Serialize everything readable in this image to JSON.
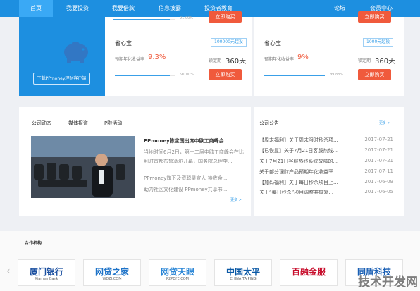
{
  "nav": {
    "items": [
      "首页",
      "我要投资",
      "我要借款",
      "信息披露",
      "投资者教育",
      "论坛",
      "会员中心"
    ]
  },
  "banner": {
    "download_label": "下载PPmoney理财客户端"
  },
  "products": [
    {
      "progress_text": "91.00%",
      "buy_label": "立即购买",
      "progress": 0.91
    },
    {
      "buy_label": "立即购买"
    },
    {
      "name": "省心宝",
      "tag": "100000元起投",
      "rate_label": "预期年化收益率",
      "rate": "9.3%",
      "period_label": "锁定期",
      "period": "360天",
      "progress_text": "91.00%",
      "progress": 0.91,
      "buy_label": "立即购买"
    },
    {
      "name": "省心宝",
      "tag": "1000元起投",
      "rate_label": "预期年化收益率",
      "rate": "9%",
      "period_label": "锁定期",
      "period": "360天",
      "progress_text": "99.88%",
      "progress": 0.9988,
      "buy_label": "立即购买"
    }
  ],
  "news": {
    "tabs": [
      "公司动态",
      "媒体报道",
      "P啦活动"
    ],
    "headline": "PPmoney陈宝国出席中欧工商峰会",
    "summary": [
      "当地时间6月2日，第十二届中欧工商峰会在比",
      "利时首都布鲁塞尔开幕，国务院总理李..."
    ],
    "items": [
      "PPmoney旗下及资聪星宣人 待收余...",
      "助力社区文化建设 PPmoney共享书..."
    ],
    "more": "更多 >"
  },
  "announcements": {
    "title": "公司公告",
    "more": "更多 >",
    "items": [
      {
        "text": "【周末福利】关于周末限时秒杀项...",
        "date": "2017-07-21"
      },
      {
        "text": "【已恢复】关于7月21日客服热线...",
        "date": "2017-07-21"
      },
      {
        "text": "关于7月21日客服热线系统故障的...",
        "date": "2017-07-21"
      },
      {
        "text": "关于部分理财产品预期年化收益率...",
        "date": "2017-07-11"
      },
      {
        "text": "【加码福利】关于每日秒杀项目上...",
        "date": "2017-06-09"
      },
      {
        "text": "关于“每日秒杀”项目调整并恢复...",
        "date": "2017-06-05"
      }
    ]
  },
  "partners": {
    "title": "合作机构",
    "items": [
      {
        "name": "厦门银行",
        "sub": "Xiamen Bank",
        "color": "#1a4fa0"
      },
      {
        "name": "网贷之家",
        "sub": "WDZJ.COM",
        "color": "#1e73c8"
      },
      {
        "name": "网贷天眼",
        "sub": "P2PEYE.COM",
        "color": "#2a86d6"
      },
      {
        "name": "中国太平",
        "sub": "CHINA TAIPING",
        "color": "#0c5aa6"
      },
      {
        "name": "百融金服",
        "sub": "",
        "color": "#c8102e"
      },
      {
        "name": "同盾科技",
        "sub": "",
        "color": "#1a5fb4"
      }
    ]
  },
  "watermark": "技术开发网"
}
